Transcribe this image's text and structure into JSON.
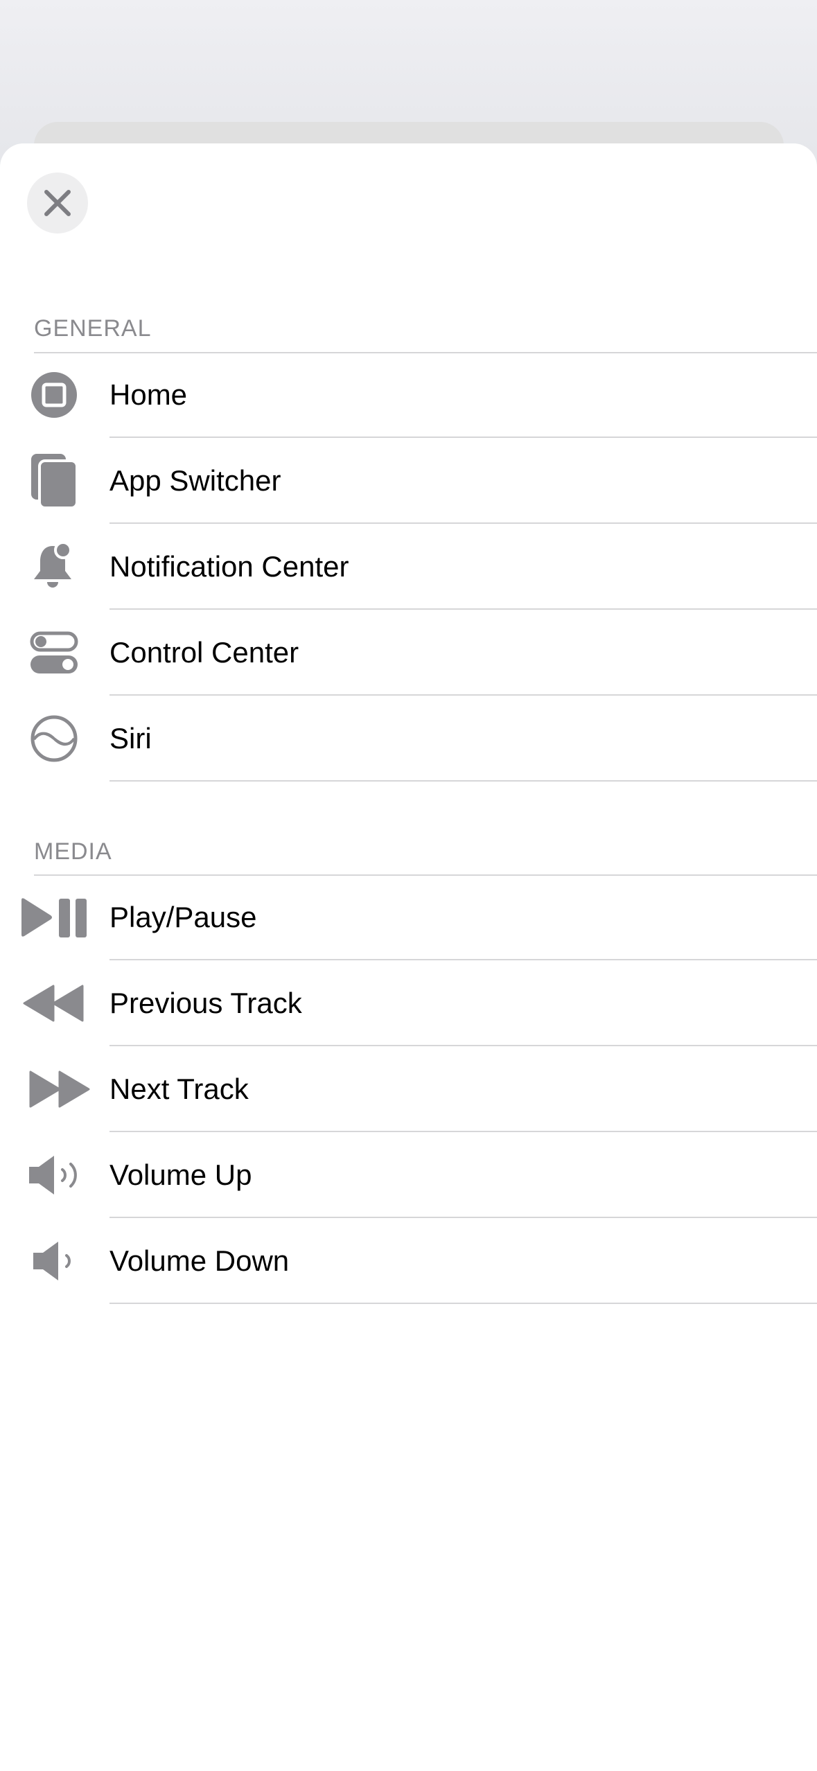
{
  "close_button": {
    "icon": "close-icon"
  },
  "colors": {
    "icon_gray": "#8a8a8e",
    "separator": "#d6d6d8",
    "sheet": "#ffffff"
  },
  "sections": [
    {
      "title": "GENERAL",
      "items": [
        {
          "label": "Home",
          "icon": "home-button-icon"
        },
        {
          "label": "App Switcher",
          "icon": "app-switcher-icon"
        },
        {
          "label": "Notification Center",
          "icon": "bell-badge-icon"
        },
        {
          "label": "Control Center",
          "icon": "toggles-icon"
        },
        {
          "label": "Siri",
          "icon": "siri-icon"
        }
      ]
    },
    {
      "title": "MEDIA",
      "items": [
        {
          "label": "Play/Pause",
          "icon": "play-pause-icon"
        },
        {
          "label": "Previous Track",
          "icon": "backward-icon"
        },
        {
          "label": "Next Track",
          "icon": "forward-icon"
        },
        {
          "label": "Volume Up",
          "icon": "speaker-wave-2-icon"
        },
        {
          "label": "Volume Down",
          "icon": "speaker-wave-1-icon"
        }
      ]
    }
  ]
}
